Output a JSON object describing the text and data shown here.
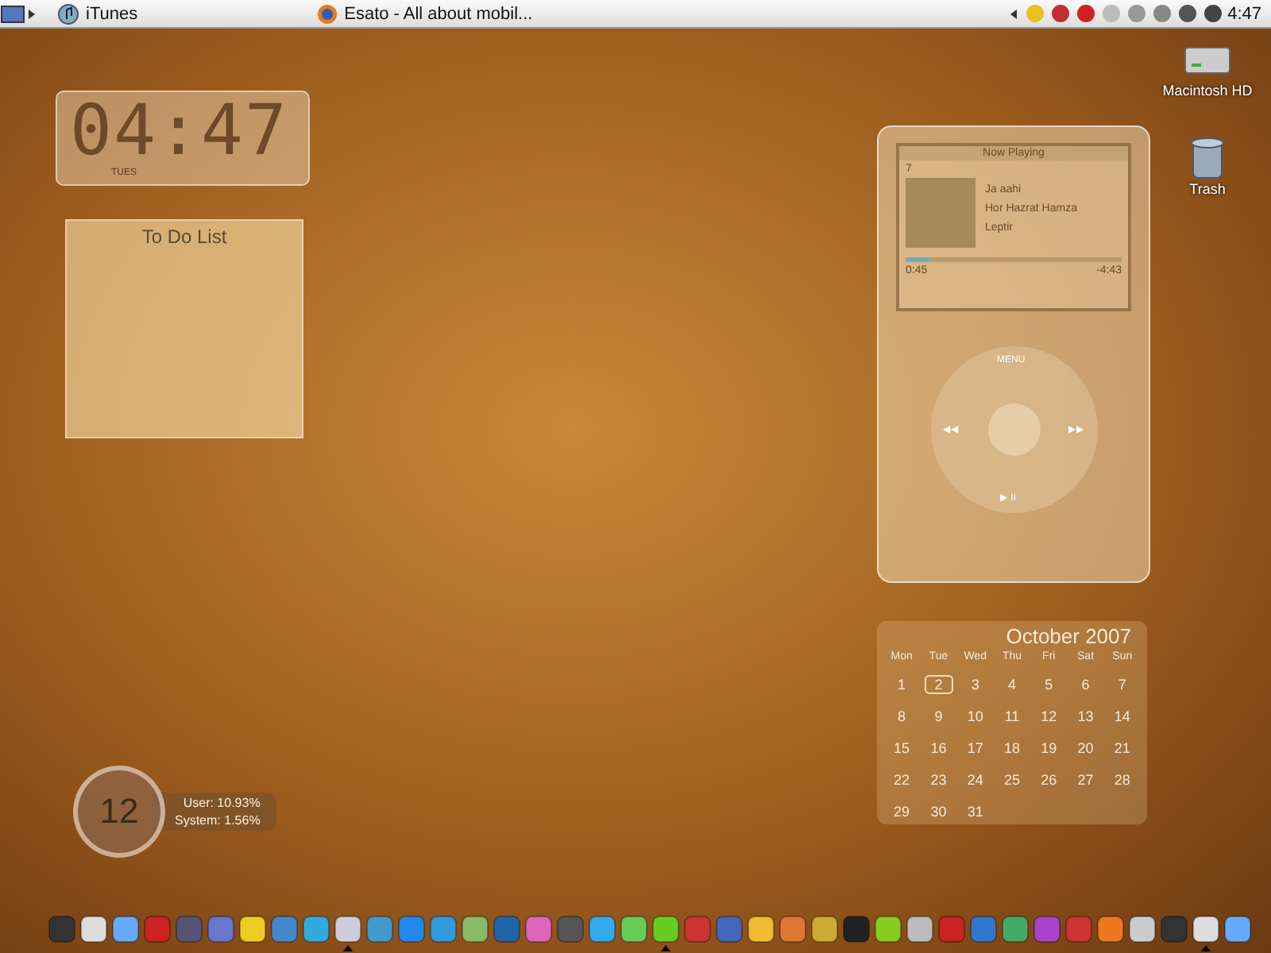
{
  "menubar": {
    "items": [
      {
        "label": "iTunes",
        "kind": "itunes"
      },
      {
        "label": "Esato - All about mobil...",
        "kind": "browser"
      }
    ],
    "clock": "4:47"
  },
  "desktop_icons": [
    {
      "label": "Macintosh HD",
      "kind": "disk"
    },
    {
      "label": "Trash",
      "kind": "trash"
    }
  ],
  "clock_widget": {
    "time": "04:47",
    "day": "TUES"
  },
  "todo_widget": {
    "title": "To Do List"
  },
  "now_playing": {
    "header": "Now Playing",
    "track_number": "7",
    "title": "Ja aahi",
    "artist": "Hor Hazrat Hamza",
    "album": "Leptir",
    "elapsed": "0:45",
    "remaining": "-4:43",
    "level": 0.12,
    "wheel": {
      "top": "MENU",
      "left": "◀◀",
      "right": "▶▶",
      "bottom": "▶ II"
    }
  },
  "calendar": {
    "title": "October 2007",
    "weekdays": [
      "Mon",
      "Tue",
      "Wed",
      "Thu",
      "Fri",
      "Sat",
      "Sun"
    ],
    "days": [
      {
        "label": "1",
        "selected": false
      },
      {
        "label": "2",
        "selected": true
      },
      {
        "label": "3",
        "selected": false
      },
      {
        "label": "4",
        "selected": false
      },
      {
        "label": "5",
        "selected": false
      },
      {
        "label": "6",
        "selected": false
      },
      {
        "label": "7",
        "selected": false
      },
      {
        "label": "8",
        "selected": false
      },
      {
        "label": "9",
        "selected": false
      },
      {
        "label": "10",
        "selected": false
      },
      {
        "label": "11",
        "selected": false
      },
      {
        "label": "12",
        "selected": false
      },
      {
        "label": "13",
        "selected": false
      },
      {
        "label": "14",
        "selected": false
      },
      {
        "label": "15",
        "selected": false
      },
      {
        "label": "16",
        "selected": false
      },
      {
        "label": "17",
        "selected": false
      },
      {
        "label": "18",
        "selected": false
      },
      {
        "label": "19",
        "selected": false
      },
      {
        "label": "20",
        "selected": false
      },
      {
        "label": "21",
        "selected": false
      },
      {
        "label": "22",
        "selected": false
      },
      {
        "label": "23",
        "selected": false
      },
      {
        "label": "24",
        "selected": false
      },
      {
        "label": "25",
        "selected": false
      },
      {
        "label": "26",
        "selected": false
      },
      {
        "label": "27",
        "selected": false
      },
      {
        "label": "28",
        "selected": false
      },
      {
        "label": "29",
        "selected": false
      },
      {
        "label": "30",
        "selected": false
      },
      {
        "label": "31",
        "selected": false
      }
    ]
  },
  "cpu_widget": {
    "dial": "12",
    "user": "User: 10.93%",
    "system": "System: 1.56%"
  },
  "dock": [
    {
      "running": false
    },
    {
      "running": false
    },
    {
      "running": false
    },
    {
      "running": false
    },
    {
      "running": false
    },
    {
      "running": false
    },
    {
      "running": false
    },
    {
      "running": false
    },
    {
      "running": false
    },
    {
      "running": true
    },
    {
      "running": false
    },
    {
      "running": false
    },
    {
      "running": false
    },
    {
      "running": false
    },
    {
      "running": false
    },
    {
      "running": false
    },
    {
      "running": false
    },
    {
      "running": false
    },
    {
      "running": false
    },
    {
      "running": true
    },
    {
      "running": false
    },
    {
      "running": false
    },
    {
      "running": false
    },
    {
      "running": false
    },
    {
      "running": false
    },
    {
      "running": false
    },
    {
      "running": false
    },
    {
      "running": false
    },
    {
      "running": false
    },
    {
      "running": false
    },
    {
      "running": false
    },
    {
      "running": false
    },
    {
      "running": false
    },
    {
      "running": false
    },
    {
      "running": false
    },
    {
      "running": false
    },
    {
      "running": true
    },
    {
      "running": false
    }
  ]
}
